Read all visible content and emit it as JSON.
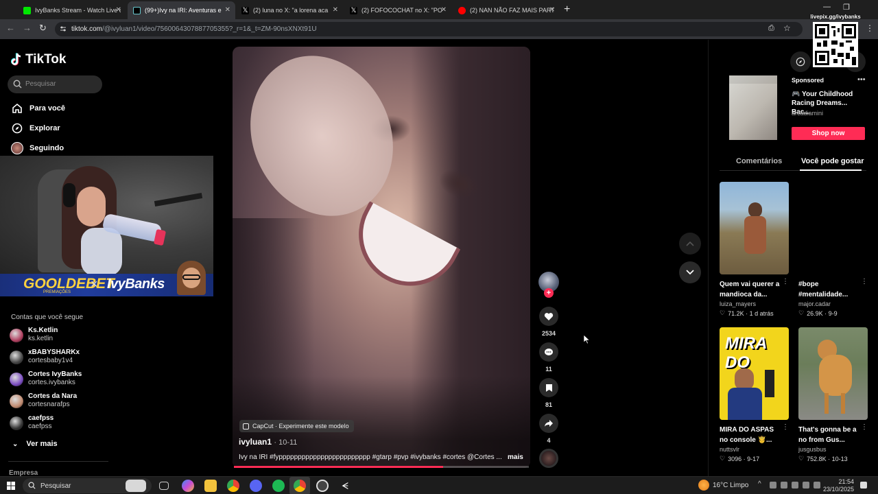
{
  "browser": {
    "tabs": [
      {
        "title": "IvyBanks Stream - Watch Live o",
        "favicon_color": "#00e701"
      },
      {
        "title": "(99+)Ivy na IRI: Aventuras e",
        "favicon_color": "#000000"
      },
      {
        "title": "(2) luna no X: \"a lorena aca",
        "favicon_color": "#000000"
      },
      {
        "title": "(2) FOFOCOCHAT no X: \"PO",
        "favicon_color": "#000000"
      },
      {
        "title": "(2) NAN NÃO FAZ MAIS PARTE",
        "favicon_color": "#ff0000"
      }
    ],
    "new_tab": "+",
    "url_host": "tiktok.com",
    "url_path": "/@ivyluan1/video/7560064307887705355?_r=1&_t=ZM-90nsXNXt91U"
  },
  "overlay": {
    "livepix_label": "livepix.gg/ivybanks"
  },
  "nav": {
    "logo": "TikTok",
    "search_placeholder": "Pesquisar",
    "items": [
      {
        "label": "Para você"
      },
      {
        "label": "Explorar"
      },
      {
        "label": "Seguindo"
      }
    ]
  },
  "stream_overlay": {
    "sponsor": "GOOLDEBET",
    "sponsor_sub": "PREMIAÇÕES",
    "times": "×",
    "streamer": "IvyBanks"
  },
  "following": {
    "title": "Contas que você segue",
    "accounts": [
      {
        "name": "Ks.Ketlin",
        "handle": "ks.ketlin",
        "color": "#b04060"
      },
      {
        "name": "xBABYSHARKx",
        "handle": "cortesbaby1v4",
        "color": "#444444"
      },
      {
        "name": "Cortes IvyBanks",
        "handle": "cortes.ivybanks",
        "color": "#7a4bc0"
      },
      {
        "name": "Cortes da Nara",
        "handle": "cortesnarafps",
        "color": "#c08a70"
      },
      {
        "name": "caefpss",
        "handle": "caefpss",
        "color": "#333333"
      }
    ],
    "see_more": "Ver mais",
    "footer": "Empresa"
  },
  "video": {
    "capcut_label": "CapCut · Experimente este modelo",
    "author": "ivyluan1",
    "date": "10-11",
    "caption": "Ivy na IRI #fypppppppppppppppppppppppp #gtarp #pvp #ivybanks #cortes @Cortes ...",
    "more": "mais",
    "progress": 0.71,
    "likes": "2534",
    "comments": "11",
    "saves": "81",
    "shares": "4",
    "follow_plus": "+"
  },
  "ad": {
    "sponsored": "Sponsored",
    "title": "🎮 Your Childhood Racing Dreams... Bac...",
    "brand": "arcadiamini",
    "cta": "Shop now"
  },
  "right_tabs": {
    "comments": "Comentários",
    "you_may_like": "Você pode gostar"
  },
  "recommendations": [
    {
      "title": "Quem vai querer a mandioca da...",
      "author": "luiza_mayers",
      "stats": "71.2K · 1 d atrás"
    },
    {
      "title": "#bope #mentalidade...",
      "author": "major.cadar",
      "stats": "26.9K · 9-9"
    },
    {
      "title": "MIRA DO ASPAS no console 🤴...",
      "author": "nuttsvlr",
      "stats": "3096 · 9-17",
      "thumb_text": "MIRA DO"
    },
    {
      "title": "That's gonna be a no from Gus...",
      "author": "jusgusbus",
      "stats": "752.8K · 10-13"
    }
  ],
  "taskbar": {
    "search": "Pesquisar",
    "weather": "16°C  Limpo",
    "time": "21:54",
    "date": "23/10/2025"
  },
  "colors": {
    "accent": "#fe2c55",
    "background": "#000000",
    "panel": "#1e1e1e"
  }
}
